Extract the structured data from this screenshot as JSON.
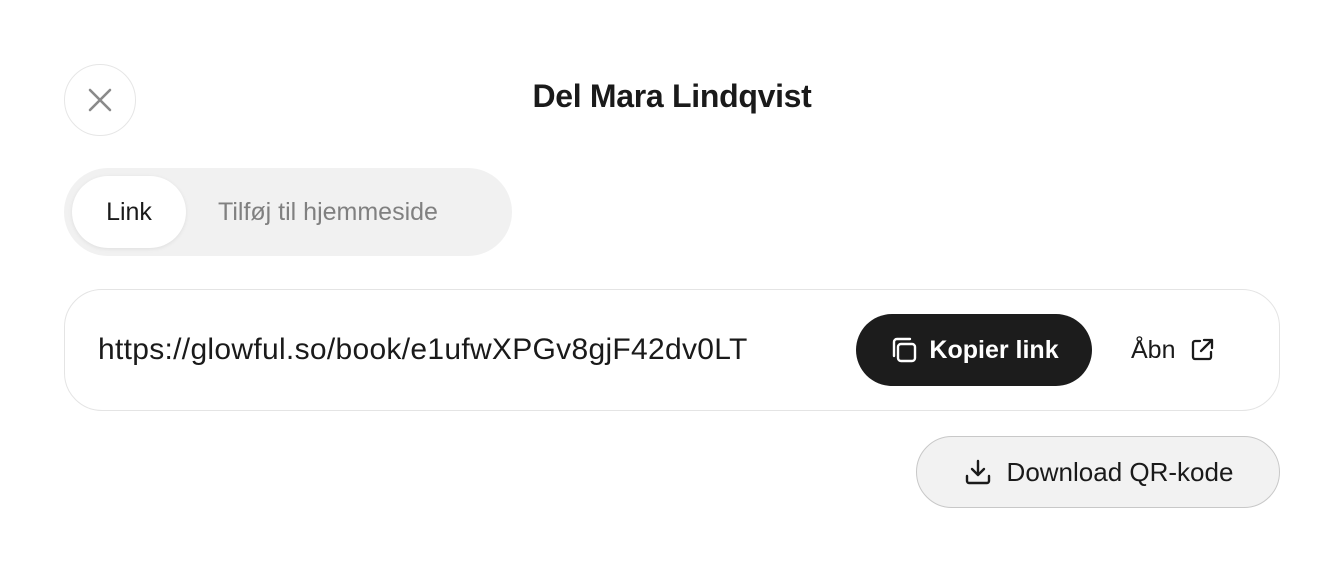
{
  "dialog": {
    "title": "Del Mara Lindqvist"
  },
  "icons": {
    "close": "close-icon",
    "copy": "copy-icon",
    "external_link": "external-link-icon",
    "download": "download-icon"
  },
  "tabs": [
    {
      "label": "Link",
      "active": true
    },
    {
      "label": "Tilføj til hjemmeside",
      "active": false
    }
  ],
  "link": {
    "url": "https://glowful.so/book/e1ufwXPGv8gjF42dv0LT",
    "copy_label": "Kopier link",
    "open_label": "Åbn"
  },
  "qr": {
    "download_label": "Download QR-kode"
  },
  "colors": {
    "primary_button": "#1c1c1c",
    "tab_track": "#f1f1f1",
    "muted_text": "#808080"
  }
}
